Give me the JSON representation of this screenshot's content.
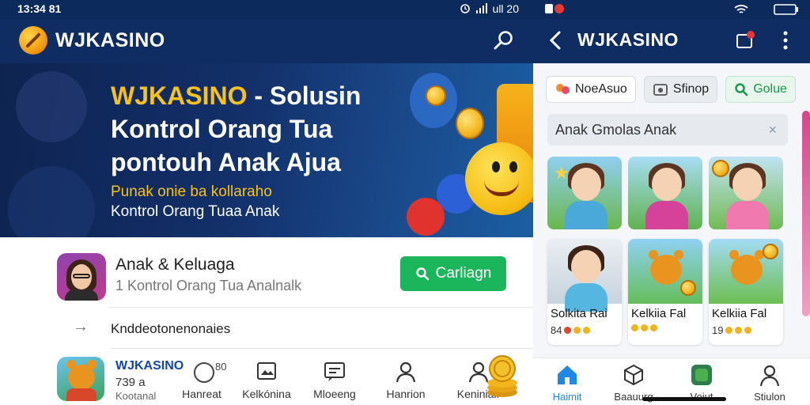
{
  "left": {
    "status": {
      "time": "13:34 81",
      "indicators": "ull 20"
    },
    "appbar": {
      "brand": "WJKASINO",
      "search_icon": "search-icon"
    },
    "banner": {
      "title_highlight": "WJKASINO",
      "title_rest_line1": "- Solusin",
      "title_line2": "Kontrol Orang Tua",
      "title_line3": "pontouh Anak Ajua",
      "subtitle_yellow": "Punak onie ba kollaraho",
      "subtitle_white": "Kontrol Orang Tuaa Anak",
      "colors": {
        "highlight": "#f7c21b",
        "background": "#13306a"
      }
    },
    "profile": {
      "name": "Anak & Keluaga",
      "subtitle": "1 Kontrol Orang Tua Analnalk",
      "button_label": "Carliagn",
      "button_color": "#1bb55c"
    },
    "link_row": {
      "label": "Knddeotonenonaies"
    },
    "bottom": {
      "brand": "WJKASINO",
      "number": "739 a",
      "sub": "Kootanal",
      "ring_count": "80",
      "items": [
        {
          "label": "Hanreat",
          "icon": "circle-icon"
        },
        {
          "label": "Kelkónina",
          "icon": "image-icon"
        },
        {
          "label": "Mloeeng",
          "icon": "message-icon"
        },
        {
          "label": "Hanrion",
          "icon": "person-icon"
        },
        {
          "label": "Keniniair",
          "icon": "person-icon"
        }
      ]
    }
  },
  "right": {
    "appbar": {
      "brand": "WJKASINO",
      "badge": "n"
    },
    "chips": [
      {
        "label": "NoeAsuo",
        "icon": "family-icon"
      },
      {
        "label": "Sfinop",
        "icon": "store-icon"
      },
      {
        "label": "Golue",
        "icon": "search-icon"
      }
    ],
    "search": {
      "value": "Anak Gmolas Anak",
      "clear": "×"
    },
    "cards": [
      {
        "title": "Solkita Rai",
        "rating": "84"
      },
      {
        "title": "Kelkiia Fal",
        "rating": ""
      },
      {
        "title": "Kelkiia Fal",
        "rating": "19"
      }
    ],
    "nav": [
      {
        "label": "Haimit",
        "icon": "home-icon",
        "active": true
      },
      {
        "label": "Baauurg",
        "icon": "cube-icon",
        "active": false
      },
      {
        "label": "Voiut",
        "icon": "app-icon",
        "active": false
      },
      {
        "label": "Stiulon",
        "icon": "person-icon",
        "active": false
      }
    ]
  }
}
